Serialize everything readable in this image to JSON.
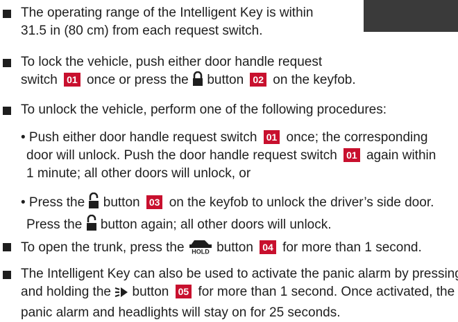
{
  "items": [
    {
      "line1": "The operating range of the Intelligent Key is within",
      "line2": "31.5 in (80 cm) from each request switch."
    },
    {
      "line1": "To lock the vehicle, push either door handle request",
      "line2_a": "switch",
      "badge1": "01",
      "line2_b": "once or press the",
      "line2_c": "button",
      "badge2": "02",
      "line2_d": "on the keyfob."
    },
    {
      "line1": "To unlock the vehicle, perform one of the following procedures:"
    },
    {
      "line1": "To open the trunk, press the",
      "line1_b": "button",
      "badge": "04",
      "line1_c": "for more than 1 second."
    },
    {
      "line1_a": "The Intelligent Key can also be used to activate the panic alarm by pressing",
      "line2_a": "and holding the",
      "line2_b": "button",
      "badge": "05",
      "line2_c": "for more than 1 second. Once activated, the",
      "line3": "panic alarm and headlights will stay on for 25 seconds."
    }
  ],
  "sub": [
    {
      "l1_a": "• Push either door handle request switch",
      "badge1": "01",
      "l1_b": "once; the corresponding",
      "l2_a": "door will unlock. Push the door handle request switch",
      "badge2": "01",
      "l2_b": "again within",
      "l3": "1 minute; all other doors will unlock, or"
    },
    {
      "l1_a": "• Press the",
      "l1_b": "button",
      "badge": "03",
      "l1_c": "on the keyfob to unlock the driver’s side door.",
      "l2_a": "Press the",
      "l2_b": "button again; all other doors will unlock."
    }
  ],
  "icons": {
    "lock": "lock-icon",
    "unlock": "unlock-icon",
    "trunk": "trunk-hold-icon",
    "panic": "panic-alarm-icon"
  },
  "colors": {
    "badge": "#c8102e",
    "text": "#1e1e1e"
  }
}
